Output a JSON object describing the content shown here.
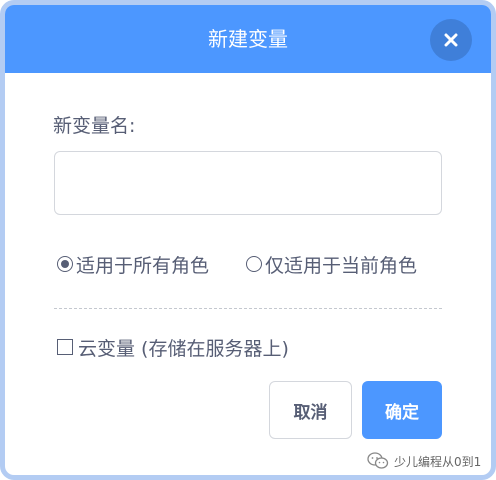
{
  "dialog": {
    "title": "新建变量",
    "close_icon": "close-icon",
    "name_label": "新变量名:",
    "name_input": {
      "value": "",
      "placeholder": ""
    },
    "scope_options": [
      {
        "label": "适用于所有角色",
        "selected": true
      },
      {
        "label": "仅适用于当前角色",
        "selected": false
      }
    ],
    "cloud_variable": {
      "label": "云变量 (存储在服务器上)",
      "checked": false
    },
    "buttons": {
      "cancel": "取消",
      "ok": "确定"
    }
  },
  "watermark": {
    "icon": "wechat-icon",
    "text": "少儿编程从0到1"
  },
  "colors": {
    "header": "#4c97ff",
    "close_button": "#3f7fd9",
    "frame_border": "#b3ccf3",
    "text": "#575e75",
    "ok_button": "#4c97ff"
  }
}
